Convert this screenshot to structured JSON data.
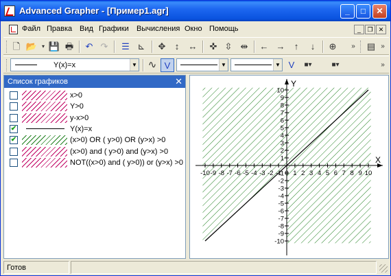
{
  "window": {
    "title": "Advanced Grapher - [Пример1.agr]"
  },
  "menu": {
    "items": [
      "Файл",
      "Правка",
      "Вид",
      "Графики",
      "Вычисления",
      "Окно",
      "Помощь"
    ]
  },
  "toolbar1": {
    "icons": [
      "new-file-icon",
      "open-folder-icon",
      "save-icon",
      "print-icon",
      "undo-icon",
      "redo-icon",
      "graph-list-icon",
      "axes-icon",
      "pan-all-icon",
      "pan-vertical-icon",
      "pan-horizontal-icon",
      "zoom-in-icon",
      "zoom-in-vertical-icon",
      "zoom-in-horizontal-icon",
      "arrow-left-icon",
      "arrow-right-icon",
      "arrow-up-icon",
      "arrow-down-icon",
      "center-icon",
      "calculator-icon"
    ]
  },
  "toolbar2": {
    "graph_select": "Y(x)=x",
    "line_style_1": "",
    "line_style_2": ""
  },
  "graph_list": {
    "title": "Список графиков",
    "items": [
      {
        "label": "x>0",
        "checked": false,
        "swatch": "hatch",
        "color": "#c00060"
      },
      {
        "label": "Y>0",
        "checked": false,
        "swatch": "hatch",
        "color": "#c00060"
      },
      {
        "label": "y-x>0",
        "checked": false,
        "swatch": "hatch",
        "color": "#c00060"
      },
      {
        "label": "Y(x)=x",
        "checked": true,
        "swatch": "line",
        "color": "#000000"
      },
      {
        "label": "(x>0) OR ( y>0)  OR  (y>x)  >0",
        "checked": true,
        "swatch": "hatch",
        "color": "#208020"
      },
      {
        "label": "(x>0) and ( y>0)  and  (y>x)  >0",
        "checked": false,
        "swatch": "hatch",
        "color": "#c00060"
      },
      {
        "label": "NOT((x>0) and ( y>0))  or  (y>x)  >0",
        "checked": false,
        "swatch": "hatch",
        "color": "#c00060"
      }
    ]
  },
  "graph": {
    "x_label": "X",
    "y_label": "Y",
    "x_ticks": [
      "-10",
      "-9",
      "-8",
      "-7",
      "-6",
      "-5",
      "-4",
      "-3",
      "-2",
      "-1",
      "0",
      "1",
      "2",
      "3",
      "4",
      "5",
      "6",
      "7",
      "8",
      "9",
      "10"
    ],
    "y_ticks": [
      "10",
      "9",
      "8",
      "7",
      "6",
      "5",
      "4",
      "3",
      "2",
      "1",
      "-1",
      "-2",
      "-3",
      "-4",
      "-5",
      "-6",
      "-7",
      "-8",
      "-9",
      "-10"
    ],
    "hatch_color": "#208020"
  },
  "status": {
    "text": "Готов"
  }
}
